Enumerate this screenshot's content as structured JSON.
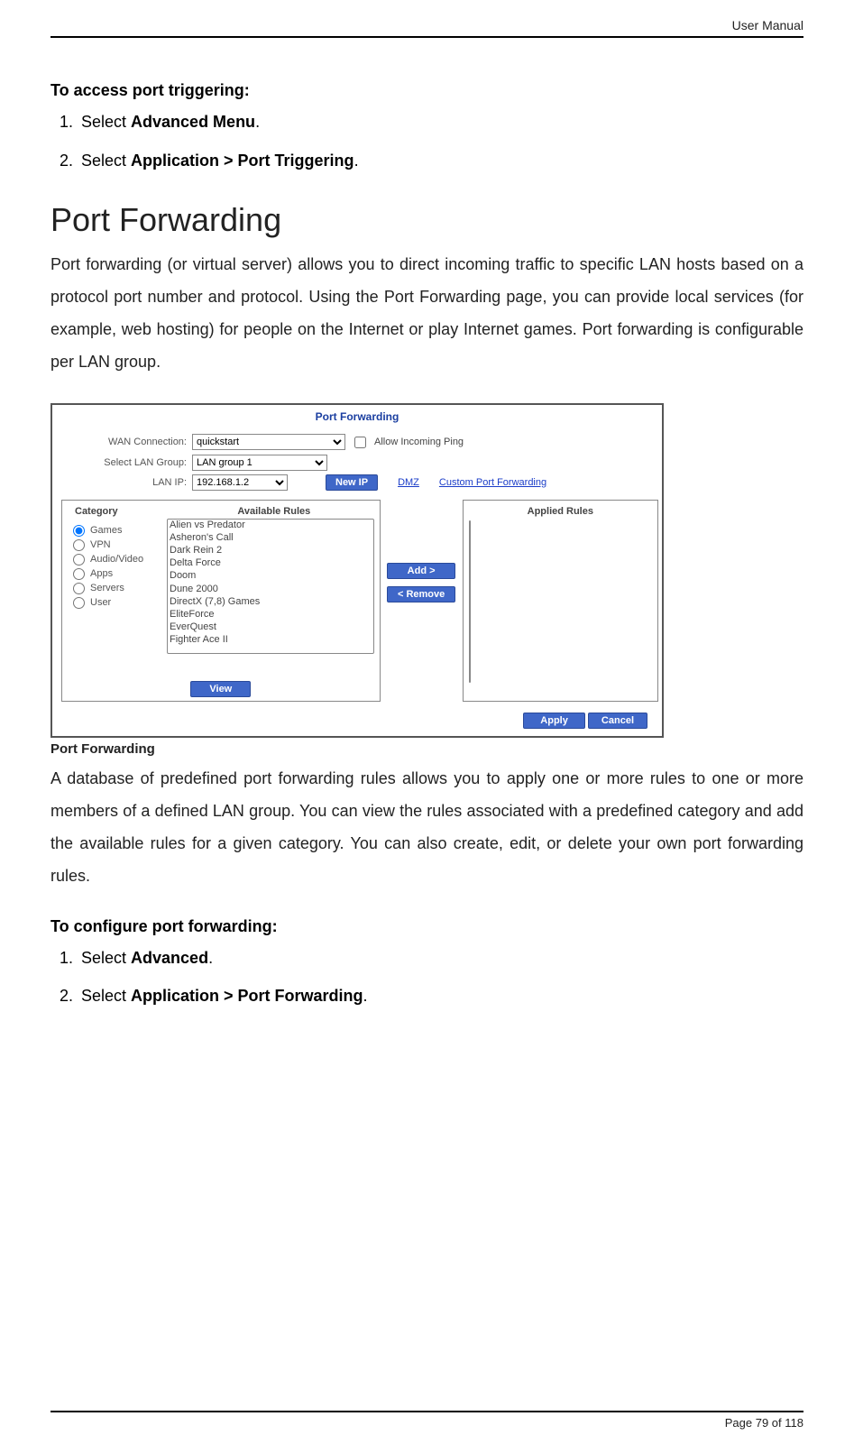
{
  "header": {
    "right": "User Manual"
  },
  "section1": {
    "title": "To access port triggering:",
    "step1_pre": "Select ",
    "step1_bold": "Advanced Menu",
    "step1_post": ".",
    "step2_pre": "Select ",
    "step2_bold": "Application > Port Triggering",
    "step2_post": "."
  },
  "heading_main": "Port Forwarding",
  "para1": "Port forwarding (or virtual server) allows you to direct incoming traffic to specific LAN hosts based on a protocol port number and protocol. Using the Port Forwarding page, you can provide local services (for example, web hosting) for people on the Internet or play Internet games. Port forwarding is configurable per LAN group.",
  "figure": {
    "title": "Port Forwarding",
    "wan_label": "WAN Connection:",
    "wan_value": "quickstart",
    "allow_ping": "Allow Incoming Ping",
    "lan_group_label": "Select LAN Group:",
    "lan_group_value": "LAN group 1",
    "lan_ip_label": "LAN IP:",
    "lan_ip_value": "192.168.1.2",
    "new_ip_btn": "New IP",
    "dmz_link": "DMZ",
    "custom_link": "Custom Port Forwarding",
    "cat_head": "Category",
    "rules_head": "Available Rules",
    "applied_head": "Applied Rules",
    "categories": [
      "Games",
      "VPN",
      "Audio/Video",
      "Apps",
      "Servers",
      "User"
    ],
    "rules": [
      "Alien vs Predator",
      "Asheron's Call",
      "Dark Rein 2",
      "Delta Force",
      "Doom",
      "Dune 2000",
      "DirectX (7,8) Games",
      "EliteForce",
      "EverQuest",
      "Fighter Ace II"
    ],
    "add_btn": "Add >",
    "remove_btn": "< Remove",
    "view_btn": "View",
    "apply_btn": "Apply",
    "cancel_btn": "Cancel"
  },
  "figure_caption": "Port Forwarding",
  "para2": "A database of predefined port forwarding rules allows you to apply one or more rules to one or more members of a defined LAN group. You can view the rules associated with a predefined category and add the available rules for a given category. You can also create, edit, or delete your own port forwarding rules.",
  "section2": {
    "title": "To configure port forwarding:",
    "step1_pre": "Select ",
    "step1_bold": "Advanced",
    "step1_post": ".",
    "step2_pre": "Select ",
    "step2_bold": "Application > Port Forwarding",
    "step2_post": "."
  },
  "footer": {
    "page": "Page 79 of 118"
  }
}
